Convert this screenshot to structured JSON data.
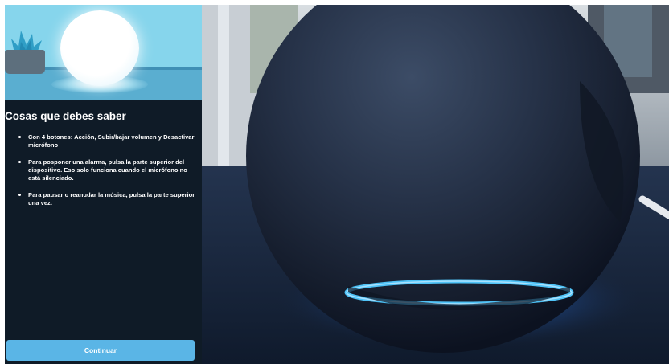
{
  "info_screen": {
    "title": "Cosas que debes saber",
    "bullets": [
      "Con 4 botones: Acción, Subir/bajar volumen y Desactivar micrófono",
      "Para posponer una alarma, pulsa la parte superior del dispositivo. Eso solo funciona cuando el micrófono no está silenciado.",
      "Para pausar o reanudar la música, pulsa la parte superior una vez."
    ],
    "continue_label": "Continuar"
  },
  "colors": {
    "panel_background": "#0f1b27",
    "illustration_sky": "#7fd0ea",
    "button_accent": "#5ab5e6",
    "light_ring": "#4fc3f7"
  },
  "icons": {
    "illustration": "smart-speaker-illustration",
    "plant": "potted-plant-icon",
    "photo": "smart-speaker-photo"
  }
}
